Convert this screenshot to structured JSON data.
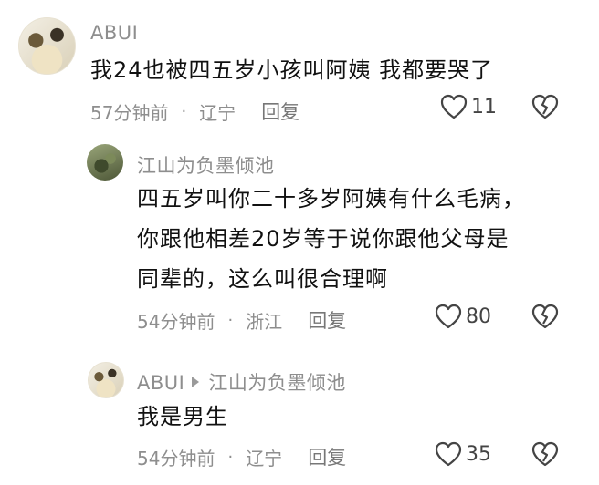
{
  "comments": [
    {
      "username": "ABUI",
      "text_lines": [
        "我24也被四五岁小孩叫阿姨 我都要哭了"
      ],
      "time": "57分钟前",
      "location": "辽宁",
      "reply_label": "回复",
      "likes": "11",
      "avatar_icon": "user-avatar-icon"
    },
    {
      "username": "江山为负墨倾池",
      "text_lines": [
        "四五岁叫你二十多岁阿姨有什么毛病，",
        "你跟他相差20岁等于说你跟他父母是",
        "同辈的，这么叫很合理啊"
      ],
      "time": "54分钟前",
      "location": "浙江",
      "reply_label": "回复",
      "likes": "80",
      "avatar_icon": "user-avatar-icon"
    },
    {
      "username": "ABUI",
      "reply_to": "江山为负墨倾池",
      "text_lines": [
        "我是男生"
      ],
      "time": "54分钟前",
      "location": "辽宁",
      "reply_label": "回复",
      "likes": "35",
      "avatar_icon": "user-avatar-icon"
    }
  ],
  "separator": "·",
  "icons": {
    "like": "heart-icon",
    "dislike": "broken-heart-icon"
  },
  "colors": {
    "text": "#111111",
    "muted": "#8e8e8e",
    "icon": "#444444"
  }
}
